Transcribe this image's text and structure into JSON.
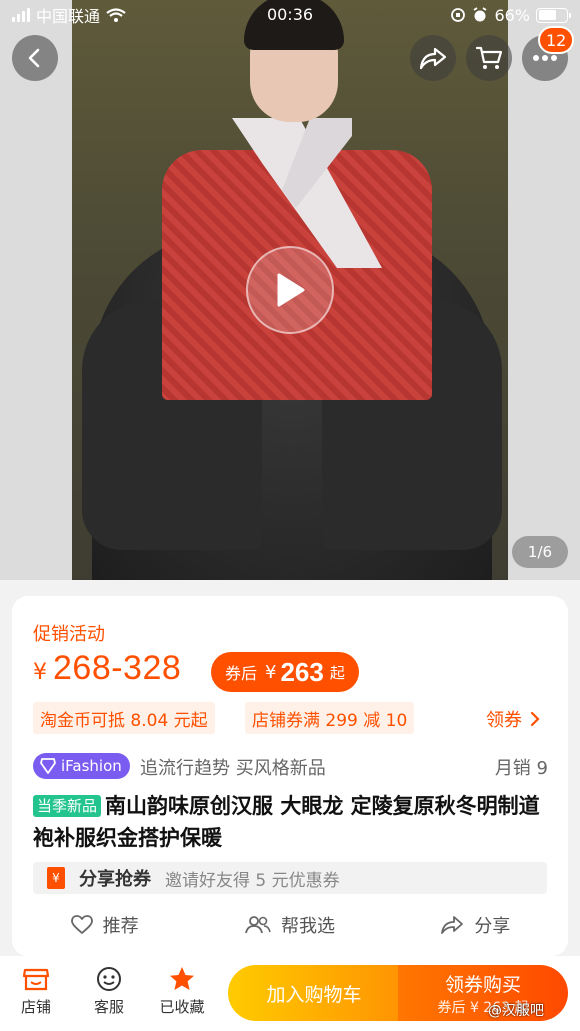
{
  "status_bar": {
    "carrier": "中国联通",
    "time": "00:36",
    "battery": "66%",
    "battery_level": 0.66
  },
  "hero": {
    "page_indicator": "1/6",
    "cart_badge": "12"
  },
  "info": {
    "promo_label": "促销活动",
    "currency": "¥",
    "price_range": "268-328",
    "coupon_price_label": "券后",
    "coupon_price_currency": "¥",
    "coupon_price_value": "263",
    "coupon_price_suffix": "起",
    "tags": [
      "淘金币可抵 8.04 元起",
      "店铺券满 299 减 10"
    ],
    "get_coupon": "领券",
    "brand_badge": "iFashion",
    "slogan": "追流行趋势 买风格新品",
    "monthly_sales": "月销 9",
    "season_tag": "当季新品",
    "title": "南山韵味原创汉服 大眼龙 定陵复原秋冬明制道袍补服织金搭护保暖",
    "share_title": "分享抢券",
    "share_desc": "邀请好友得 5 元优惠券",
    "share_icon_char": "¥",
    "actions": {
      "recommend": "推荐",
      "help_choose": "帮我选",
      "share": "分享"
    }
  },
  "bottom_bar": {
    "shop": "店铺",
    "service": "客服",
    "favorited": "已收藏",
    "add_to_cart": "加入购物车",
    "buy_label": "领券购买",
    "buy_sub": "券后 ¥ 263 起"
  },
  "watermark": "@汉服吧"
}
